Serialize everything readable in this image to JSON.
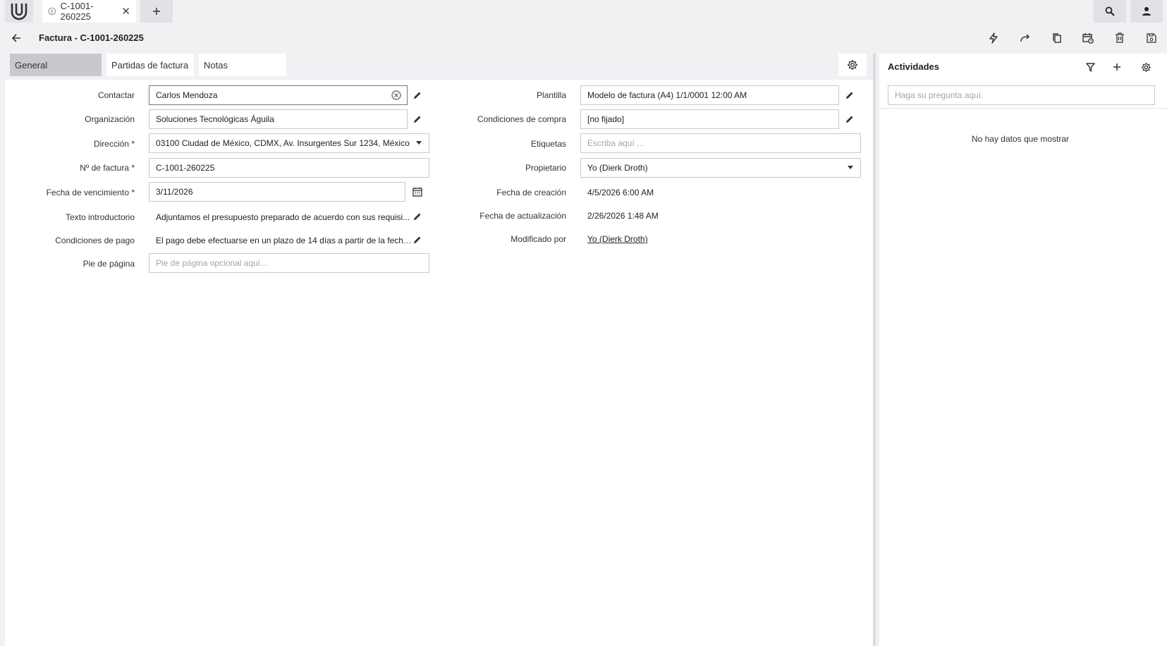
{
  "topbar": {
    "tab_label": "C-1001-260225",
    "tab_close": "✕"
  },
  "header": {
    "title": "Factura - C-1001-260225"
  },
  "tabs": [
    {
      "label": "General"
    },
    {
      "label": "Partidas de factura"
    },
    {
      "label": "Notas"
    }
  ],
  "form": {
    "contact_label": "Contactar",
    "contact_value": "Carlos Mendoza",
    "org_label": "Organización",
    "org_value": "Soluciones Tecnológicas Águila",
    "address_label": "Dirección *",
    "address_value": "03100 Ciudad de México, CDMX, Av. Insurgentes Sur 1234, México",
    "invoice_no_label": "Nº de factura *",
    "invoice_no_value": "C-1001-260225",
    "due_date_label": "Fecha de vencimiento *",
    "due_date_value": "3/11/2026",
    "intro_label": "Texto introductorio",
    "intro_value": "Adjuntamos el presupuesto preparado de acuerdo con sus requisi...",
    "payment_label": "Condiciones de pago",
    "payment_value": "El pago debe efectuarse en un plazo de 14 días a partir de la fecha...",
    "footer_label": "Pie de página",
    "footer_placeholder": "Pie de página opcional aquí...",
    "template_label": "Plantilla",
    "template_value": "Modelo de factura (A4) 1/1/0001 12:00 AM",
    "purchase_label": "Condiciones de compra",
    "purchase_value": "[no fijado]",
    "tags_label": "Etiquetas",
    "tags_placeholder": "Escriba aquí ...",
    "owner_label": "Propietario",
    "owner_value": "Yo (Dierk Droth)",
    "created_label": "Fecha de creación",
    "created_value": "4/5/2026 6:00 AM",
    "updated_label": "Fecha de actualización",
    "updated_value": "2/26/2026 1:48 AM",
    "modified_label": "Modificado por",
    "modified_value": "Yo (Dierk Droth)"
  },
  "activities": {
    "title": "Actividades",
    "search_placeholder": "Haga su pregunta aquí.",
    "empty": "No hay datos que mostrar"
  },
  "icons": {
    "header_actions": [
      "lightning-icon",
      "forward-icon",
      "copy-icon",
      "calendar-clock-icon",
      "trash-icon",
      "save-icon"
    ]
  }
}
